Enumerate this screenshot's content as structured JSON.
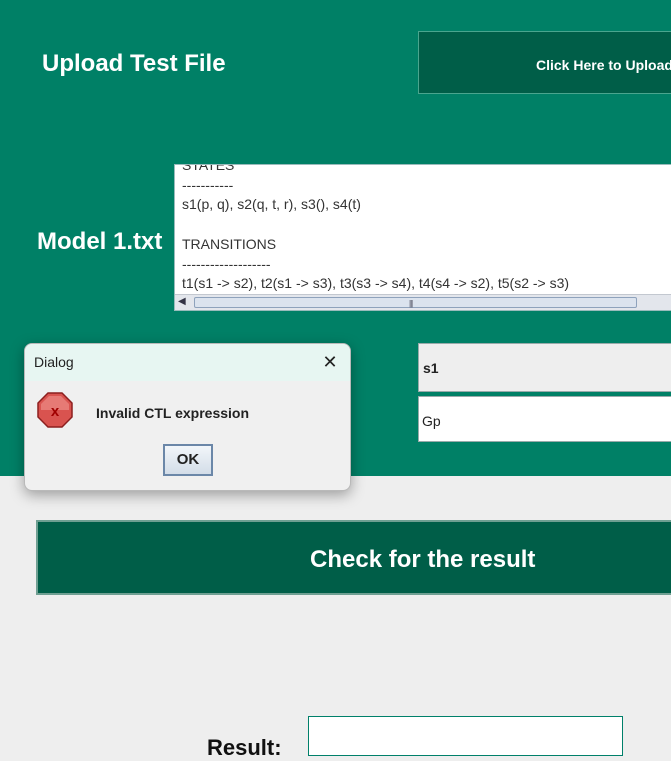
{
  "upload": {
    "title": "Upload Test File",
    "button_label": "Click Here to Upload"
  },
  "model": {
    "label": "Model 1.txt",
    "lines": [
      "STATES",
      "-----------",
      "s1(p, q), s2(q, t, r), s3(), s4(t)",
      "",
      "TRANSITIONS",
      "-------------------",
      "t1(s1 -> s2), t2(s1 -> s3), t3(s3 -> s4), t4(s4 -> s2), t5(s2 -> s3)"
    ]
  },
  "table": {
    "header": "s1",
    "value": "Gp"
  },
  "check": {
    "label": "Check for the result"
  },
  "result": {
    "label": "Result:",
    "value": ""
  },
  "dialog": {
    "title": "Dialog",
    "close_glyph": "✕",
    "icon_glyph": "x",
    "message": "Invalid CTL expression",
    "ok_label": "OK"
  },
  "colors": {
    "panel": "#008066",
    "button": "#005e48",
    "error_icon": "#d9534f"
  }
}
